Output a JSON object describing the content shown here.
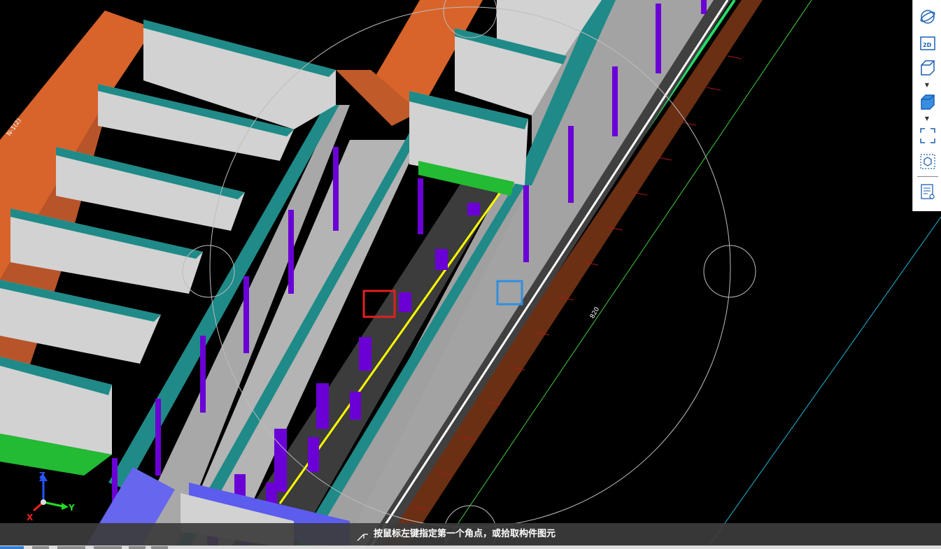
{
  "status": {
    "prompt": "按鼠标左键指定第一个角点，或拾取构件图元"
  },
  "toolbar": {
    "items": [
      {
        "id": "orbit",
        "icon": "orbit-icon"
      },
      {
        "id": "view-2d",
        "icon": "2d-view-icon",
        "label": "2D"
      },
      {
        "id": "view-3d",
        "icon": "cube-wireframe-icon"
      },
      {
        "id": "shaded",
        "icon": "cube-shaded-icon"
      },
      {
        "id": "zoom-window",
        "icon": "zoom-window-icon"
      },
      {
        "id": "zoom-extents",
        "icon": "zoom-extents-icon"
      },
      {
        "id": "properties",
        "icon": "properties-view-icon"
      }
    ]
  },
  "axis": {
    "x": "X",
    "y": "Y",
    "z": "Z"
  },
  "dimension_label": "820",
  "grid_label": "N-1(2)",
  "colors": {
    "background": "#000000",
    "concrete": "#c8c8c8",
    "cap": "#1f8a88",
    "brick": "#c4602d",
    "column": "#6b00d6",
    "rebar": "#ffff00",
    "slab": "#3c3c3c",
    "green": "#22bb33",
    "select_red": "#e02020",
    "select_blue": "#2f8fe0"
  }
}
